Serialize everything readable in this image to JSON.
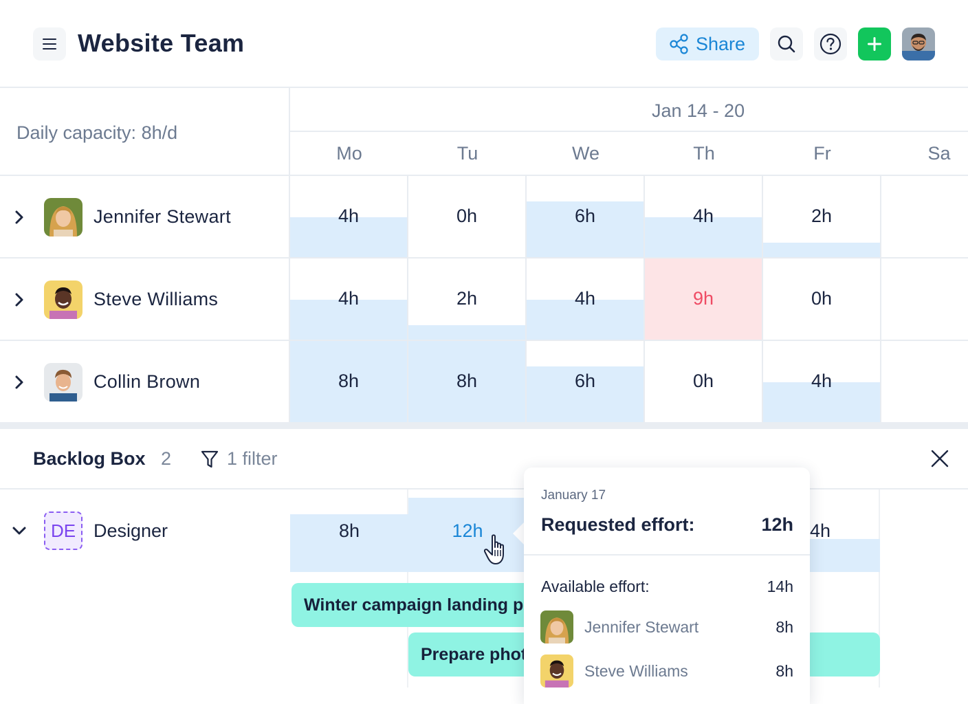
{
  "header": {
    "title": "Website Team",
    "share_label": "Share",
    "icons": [
      "menu-icon",
      "share-icon",
      "search-icon",
      "help-icon",
      "plus-icon",
      "user-avatar"
    ]
  },
  "capacity": {
    "daily_label": "Daily capacity: 8h/d",
    "week_label": "Jan 14 - 20",
    "days": [
      "Mo",
      "Tu",
      "We",
      "Th",
      "Fr",
      "Sa"
    ]
  },
  "people": [
    {
      "name": "Jennifer Stewart",
      "hours": [
        "4h",
        "0h",
        "6h",
        "4h",
        "2h"
      ],
      "fills": [
        0.5,
        0,
        0.69,
        0.5,
        0.19
      ],
      "over": [
        false,
        false,
        false,
        false,
        false
      ]
    },
    {
      "name": "Steve Williams",
      "hours": [
        "4h",
        "2h",
        "4h",
        "9h",
        "0h"
      ],
      "fills": [
        0.5,
        0.19,
        0.5,
        0,
        0
      ],
      "over": [
        false,
        false,
        false,
        true,
        false
      ]
    },
    {
      "name": "Collin Brown",
      "hours": [
        "8h",
        "8h",
        "6h",
        "0h",
        "4h"
      ],
      "fills": [
        1,
        1,
        0.69,
        0,
        0.5
      ],
      "over": [
        false,
        false,
        false,
        false,
        false
      ]
    }
  ],
  "backlog": {
    "title": "Backlog Box",
    "count": "2",
    "filter_label": "1 filter",
    "role": {
      "badge": "DE",
      "name": "Designer",
      "hours": {
        "mo": "8h",
        "tu": "12h",
        "fr": "4h"
      }
    },
    "tasks": [
      "Winter campaign landing pa",
      "Prepare phot"
    ]
  },
  "popover": {
    "date": "January 17",
    "requested_label": "Requested effort:",
    "requested_value": "12h",
    "available_label": "Available effort:",
    "available_value": "14h",
    "people": [
      {
        "name": "Jennifer Stewart",
        "hours": "8h"
      },
      {
        "name": "Steve Williams",
        "hours": "8h"
      }
    ]
  },
  "colors": {
    "accent_blue": "#1a86d6",
    "share_bg": "#e1f1fd",
    "add_green": "#12c65c",
    "capacity_fill": "#dcedfc",
    "overload_bg": "#fde4e6",
    "overload_text": "#ef4b64",
    "task_teal": "#8ff3e3",
    "role_purple": "#7a44ee"
  }
}
